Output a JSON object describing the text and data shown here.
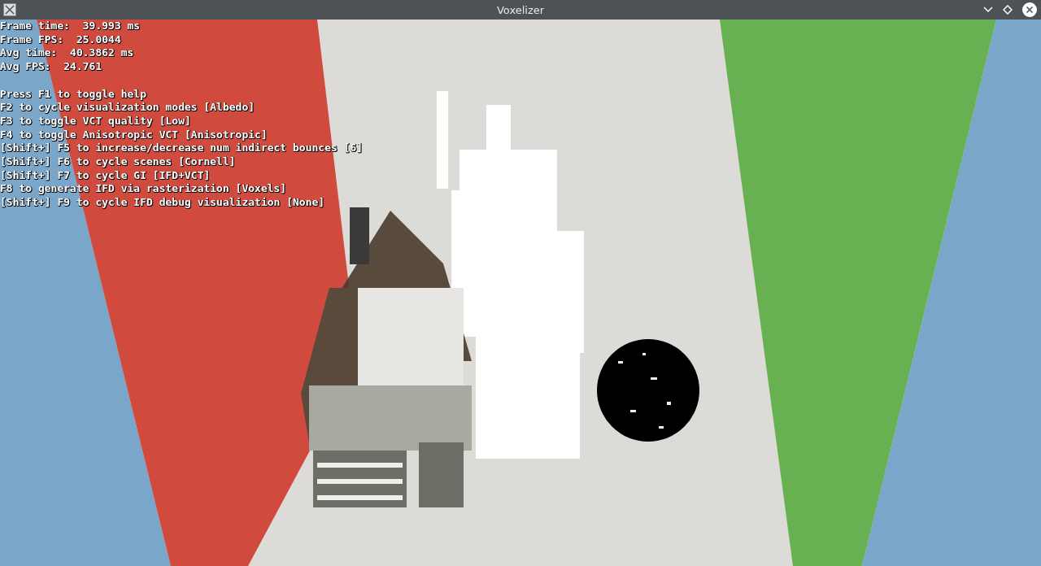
{
  "window": {
    "title": "Voxelizer"
  },
  "stats": [
    "Frame time:  39.993 ms",
    "Frame FPS:  25.0044",
    "Avg time:  40.3862 ms",
    "Avg FPS:  24.761"
  ],
  "help": [
    "Press F1 to toggle help",
    "F2 to cycle visualization modes [Albedo]",
    "F3 to toggle VCT quality [Low]",
    "F4 to toggle Anisotropic VCT [Anisotropic]",
    "[Shift+] F5 to increase/decrease num indirect bounces [6]",
    "[Shift+] F6 to cycle scenes [Cornell]",
    "[Shift+] F7 to cycle GI [IFD+VCT]",
    "F8 to generate IFD via rasterization [Voxels]",
    "[Shift+] F9 to cycle IFD debug visualization [None]"
  ]
}
